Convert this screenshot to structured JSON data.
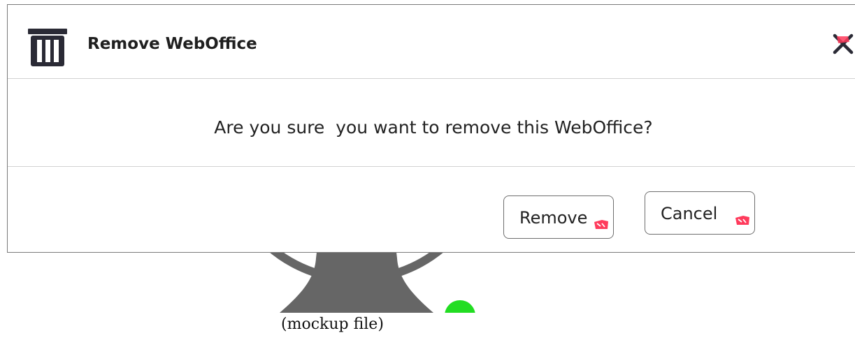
{
  "dialog": {
    "title": "Remove WebOffice",
    "title_icon": "trash-icon",
    "close_icon": "close-icon",
    "message": "Are you sure  you want to remove this WebOffice?",
    "buttons": {
      "remove_label": "Remove",
      "cancel_label": "Cancel"
    }
  },
  "background": {
    "avatar_icon": "user-avatar-icon",
    "status_indicator_color": "#22dd22"
  },
  "caption": "(mockup file)",
  "colors": {
    "icon_dark": "#2a2a35",
    "accent_pink": "#ff3b5c",
    "avatar_gray": "#666666"
  }
}
